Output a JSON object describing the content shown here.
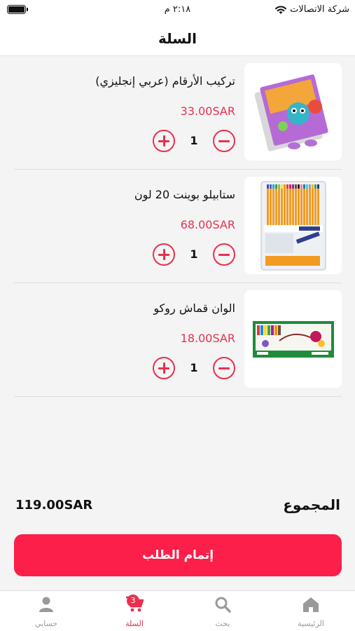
{
  "status_bar": {
    "carrier": "شركة الاتصالات",
    "time": "٢:١٨ م"
  },
  "header": {
    "title": "السلة"
  },
  "colors": {
    "accent": "#e8304f",
    "checkout_bg": "#fb1f4a"
  },
  "cart": {
    "items": [
      {
        "name": "تركيب الأرقام (عربي إنجليزي)",
        "price": "33.00SAR",
        "quantity": "1"
      },
      {
        "name": "ستابيلو بوينت 20 لون",
        "price": "68.00SAR",
        "quantity": "1"
      },
      {
        "name": "الوان قماش روكو",
        "price": "18.00SAR",
        "quantity": "1"
      }
    ]
  },
  "summary": {
    "total_label": "المجموع",
    "total_value": "119.00SAR"
  },
  "checkout": {
    "label": "إتمام الطلب"
  },
  "tabbar": {
    "items": [
      {
        "label": "الرئيسية",
        "icon": "home-icon"
      },
      {
        "label": "بحث",
        "icon": "search-icon"
      },
      {
        "label": "السلة",
        "icon": "cart-icon",
        "badge": "3",
        "active": true
      },
      {
        "label": "حسابي",
        "icon": "user-icon"
      }
    ]
  }
}
